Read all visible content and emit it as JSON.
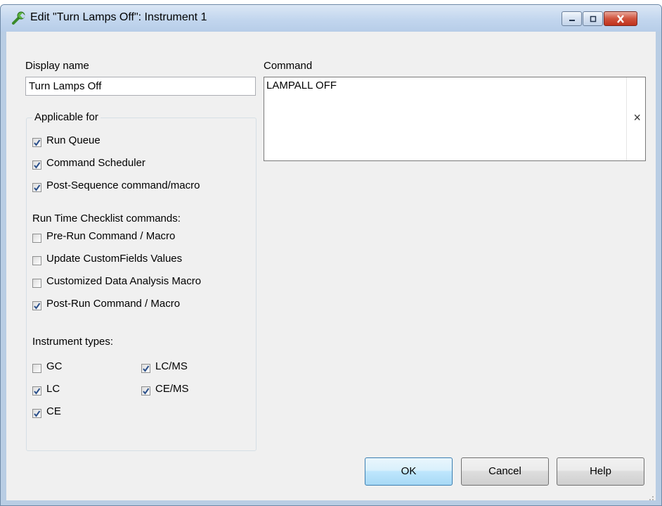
{
  "window": {
    "title": "Edit \"Turn Lamps Off\": Instrument 1",
    "icon": "wrench-icon"
  },
  "display_name": {
    "label": "Display name",
    "value": "Turn Lamps Off"
  },
  "applicable_for": {
    "legend": "Applicable for",
    "items": [
      {
        "label": "Run Queue",
        "checked": true
      },
      {
        "label": "Command Scheduler",
        "checked": true
      },
      {
        "label": "Post-Sequence command/macro",
        "checked": true
      }
    ]
  },
  "checklist": {
    "label": "Run Time Checklist commands:",
    "items": [
      {
        "label": "Pre-Run Command / Macro",
        "checked": false
      },
      {
        "label": "Update CustomFields Values",
        "checked": false
      },
      {
        "label": "Customized Data Analysis Macro",
        "checked": false
      },
      {
        "label": "Post-Run Command / Macro",
        "checked": true
      }
    ]
  },
  "instrument_types": {
    "label": "Instrument types:",
    "items": [
      {
        "label": "GC",
        "checked": false
      },
      {
        "label": "LC",
        "checked": true
      },
      {
        "label": "CE",
        "checked": true
      },
      {
        "label": "LC/MS",
        "checked": true
      },
      {
        "label": "CE/MS",
        "checked": true
      }
    ]
  },
  "command": {
    "label": "Command",
    "value": "LAMPALL OFF",
    "clear_symbol": "×"
  },
  "buttons": {
    "ok": "OK",
    "cancel": "Cancel",
    "help": "Help"
  },
  "colors": {
    "accent": "#3c7fb1",
    "close_button": "#c0321c",
    "check_mark": "#2a4f8a"
  }
}
